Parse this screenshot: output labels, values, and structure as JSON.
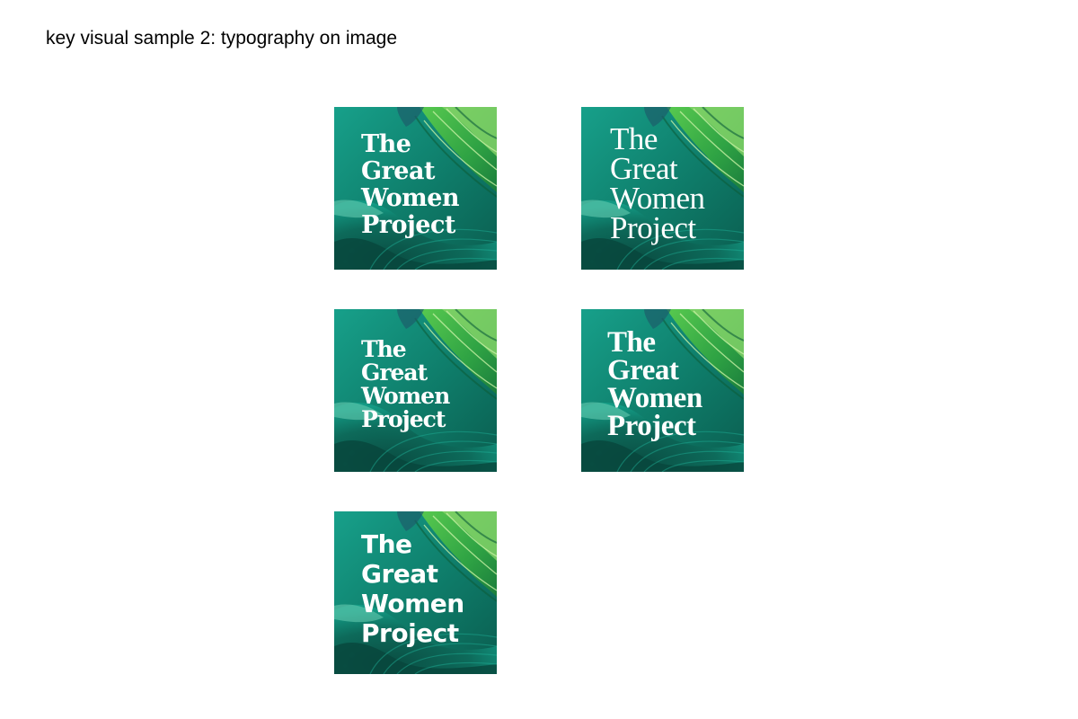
{
  "page": {
    "title": "key visual sample 2: typography on image"
  },
  "tiles": [
    {
      "lines": [
        "The",
        "Great",
        "Women",
        "Project"
      ]
    },
    {
      "lines": [
        "The",
        "Great",
        "Women",
        "Project"
      ]
    },
    {
      "lines": [
        "The",
        "Great",
        "Women",
        "Project"
      ]
    },
    {
      "lines": [
        "The",
        "Great",
        "Women",
        "Project"
      ]
    },
    {
      "lines": [
        "The",
        "Great",
        "Women",
        "Project"
      ]
    }
  ],
  "colors": {
    "background": "#ffffff",
    "title_text": "#000000",
    "headline_text": "#ffffff",
    "image_deep_teal": "#0b5a4c",
    "image_teal": "#12907a",
    "image_green": "#3dbb4a",
    "image_light_green": "#9ee08a"
  }
}
